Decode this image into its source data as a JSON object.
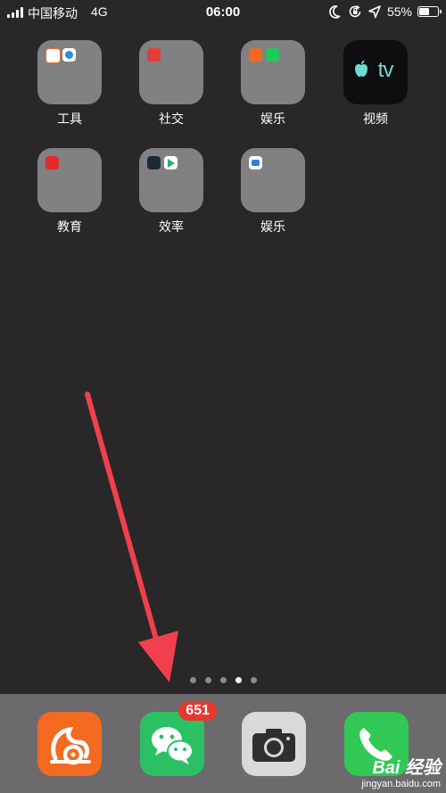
{
  "status_bar": {
    "carrier": "中国移动",
    "network": "4G",
    "time": "06:00",
    "battery_percent": "55%",
    "icons": [
      "signal-bars-icon",
      "moon-icon",
      "rotation-lock-icon",
      "location-arrow-icon",
      "battery-icon"
    ]
  },
  "home": {
    "apps": [
      {
        "label": "工具",
        "kind": "folder"
      },
      {
        "label": "社交",
        "kind": "folder"
      },
      {
        "label": "娱乐",
        "kind": "folder"
      },
      {
        "label": "视频",
        "kind": "app",
        "icon": "apple-tv-icon"
      },
      {
        "label": "教育",
        "kind": "folder"
      },
      {
        "label": "效率",
        "kind": "folder"
      },
      {
        "label": "娱乐",
        "kind": "folder"
      }
    ],
    "apple_tv_text": "tv"
  },
  "page_indicator": {
    "count": 5,
    "active_index": 3
  },
  "dock": {
    "apps": [
      {
        "name": "uc-browser",
        "icon": "squirrel-icon",
        "color": "#f46a21"
      },
      {
        "name": "wechat",
        "icon": "chat-bubbles-icon",
        "color": "#2cc064",
        "badge": "651"
      },
      {
        "name": "camera",
        "icon": "camera-icon",
        "color": "#d9d9d9"
      },
      {
        "name": "phone",
        "icon": "phone-handset-icon",
        "color": "#31c856"
      }
    ]
  },
  "annotation": {
    "color": "#f1404d"
  },
  "watermark": {
    "logo": "Bai 经验",
    "url": "jingyan.baidu.com"
  }
}
